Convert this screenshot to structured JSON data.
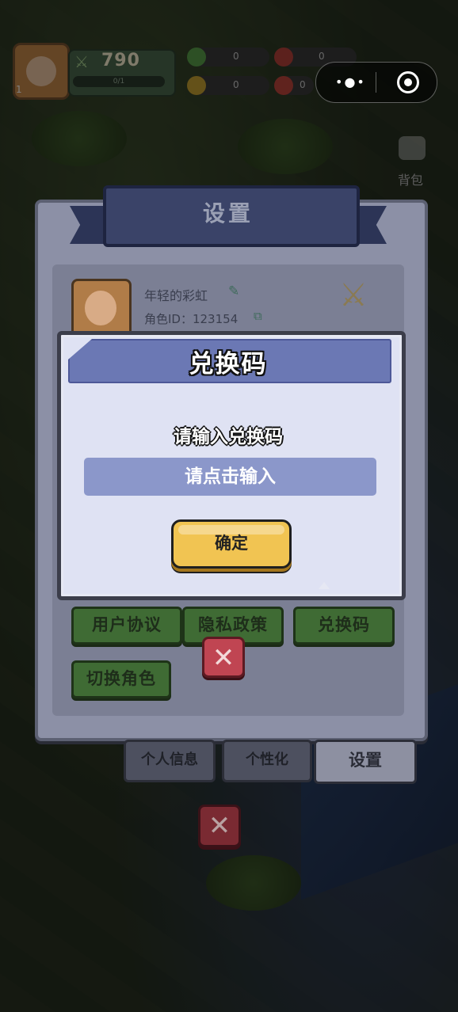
{
  "hud": {
    "level": "1",
    "power_value": "790",
    "power_bar_text": "0/1",
    "resources": [
      {
        "icon": "green-gem-icon",
        "value": "0"
      },
      {
        "icon": "red-fruit-icon",
        "value": "0"
      },
      {
        "icon": "gold-coin-icon",
        "value": "0"
      },
      {
        "icon": "red-potion-icon",
        "value": "0"
      }
    ]
  },
  "side_menu": {
    "bag_label": "背包"
  },
  "settings_panel": {
    "title": "设置",
    "profile": {
      "name": "年轻的彩虹",
      "role_id": "角色ID：123154"
    },
    "buttons": {
      "user_agreement": "用户协议",
      "privacy_policy": "隐私政策",
      "redeem_code": "兑换码",
      "switch_role": "切换角色"
    },
    "tabs": [
      {
        "label": "个人信息",
        "active": false
      },
      {
        "label": "个性化",
        "active": false
      },
      {
        "label": "设置",
        "active": true
      }
    ]
  },
  "redeem_dialog": {
    "title": "兑换码",
    "label": "请输入兑换码",
    "input_placeholder": "请点击输入",
    "input_value": "",
    "confirm_label": "确定"
  },
  "colors": {
    "dialog_header": "#6b78b4",
    "input_bg": "#8b97ca",
    "confirm_button": "#f1c452",
    "close_button": "#c04552",
    "green_button": "#3f6b34"
  }
}
